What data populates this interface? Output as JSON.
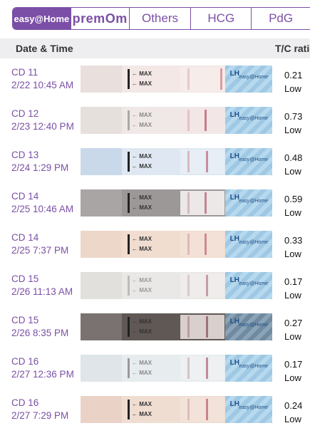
{
  "tabs": {
    "easy_home": "easy@Home",
    "premom": "premOm",
    "others": "Others",
    "hcg": "HCG",
    "pdg": "PdG"
  },
  "header": {
    "date_time": "Date & Time",
    "tc_ratio": "T/C ratio"
  },
  "strip_text": {
    "max": "MAX",
    "lh": "LH",
    "brand": "easy@Home"
  },
  "rows": [
    {
      "cd": "CD 11",
      "datetime": "2/22 10:45 AM",
      "ratio": "0.21",
      "level": "Low"
    },
    {
      "cd": "CD 12",
      "datetime": "2/23 12:40 PM",
      "ratio": "0.73",
      "level": "Low"
    },
    {
      "cd": "CD 13",
      "datetime": "2/24 1:29 PM",
      "ratio": "0.48",
      "level": "Low"
    },
    {
      "cd": "CD 14",
      "datetime": "2/25 10:46 AM",
      "ratio": "0.59",
      "level": "Low"
    },
    {
      "cd": "CD 14",
      "datetime": "2/25 7:37 PM",
      "ratio": "0.33",
      "level": "Low"
    },
    {
      "cd": "CD 15",
      "datetime": "2/26 11:13 AM",
      "ratio": "0.17",
      "level": "Low"
    },
    {
      "cd": "CD 15",
      "datetime": "2/26 8:35 PM",
      "ratio": "0.27",
      "level": "Low"
    },
    {
      "cd": "CD 16",
      "datetime": "2/27 12:36 PM",
      "ratio": "0.17",
      "level": "Low"
    },
    {
      "cd": "CD 16",
      "datetime": "2/27 7:29 PM",
      "ratio": "0.24",
      "level": "Low"
    }
  ],
  "colors": {
    "accent": "#7b4fa6",
    "header_bg": "#eeeef0"
  }
}
